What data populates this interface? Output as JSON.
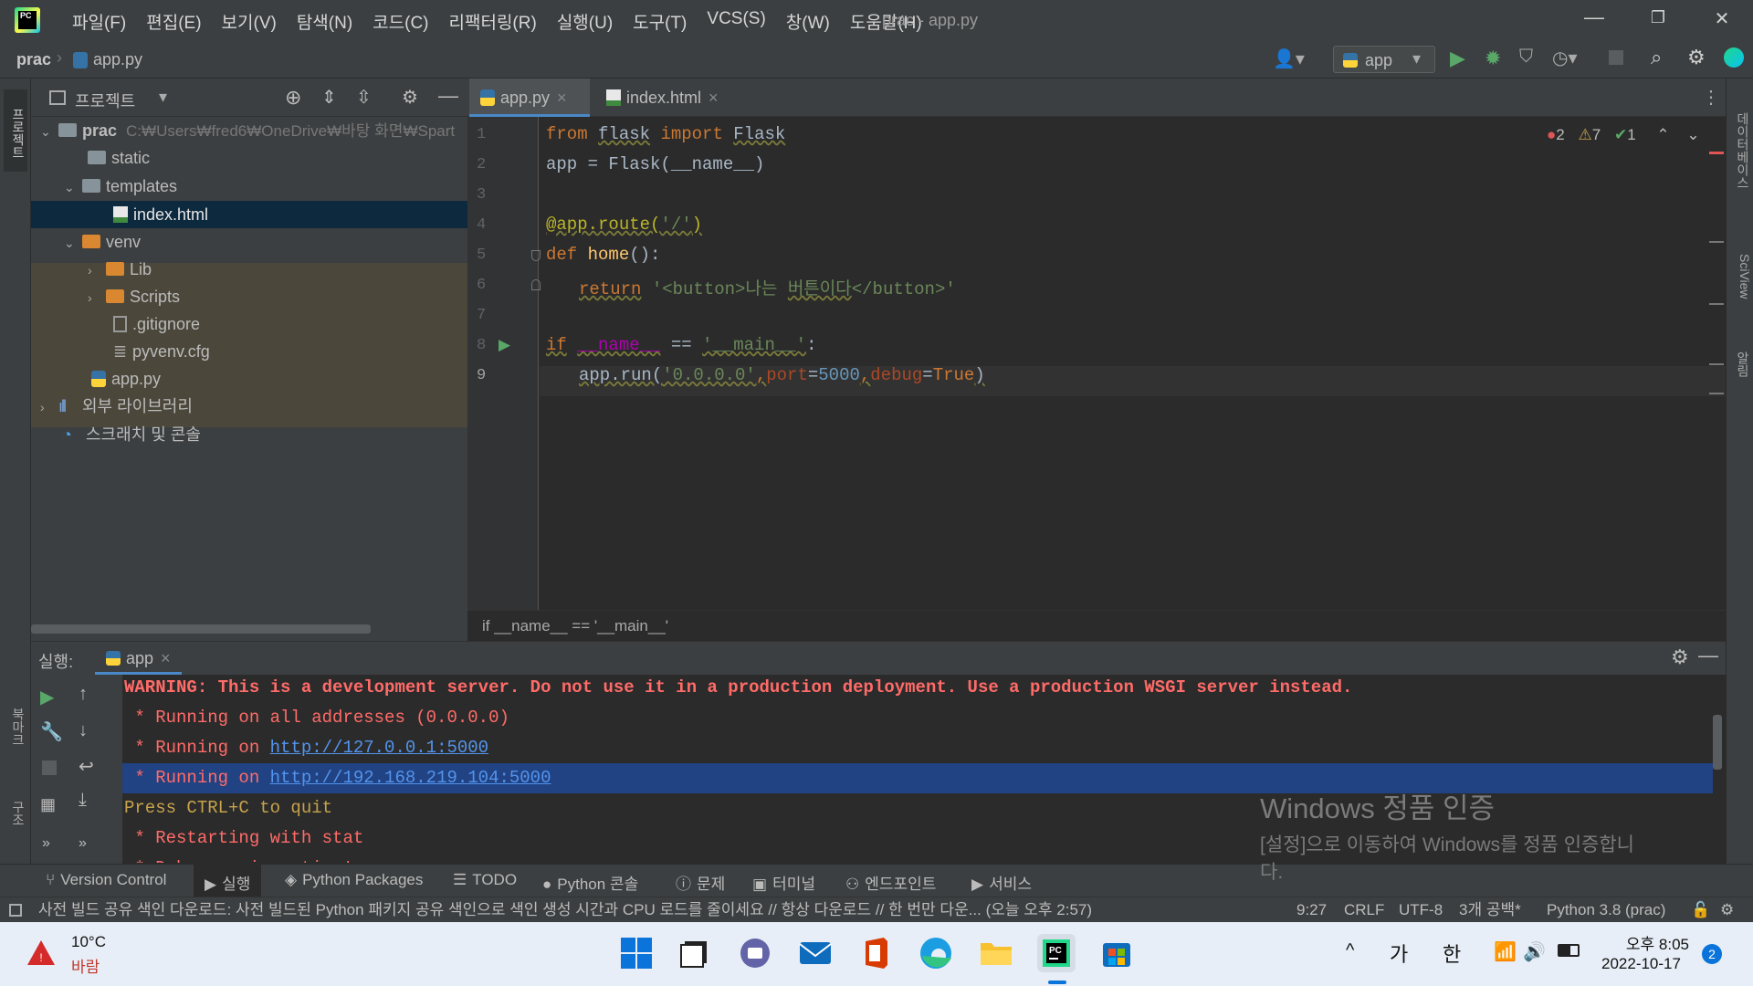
{
  "window": {
    "menus": [
      "파일(F)",
      "편집(E)",
      "보기(V)",
      "탐색(N)",
      "코드(C)",
      "리팩터링(R)",
      "실행(U)",
      "도구(T)",
      "VCS(S)",
      "창(W)",
      "도움말(H)"
    ],
    "title": "prac - app.py",
    "minimize": "—",
    "restore": "❐",
    "close": "✕"
  },
  "navbar": {
    "project": "prac",
    "file": "app.py",
    "run_config": "app"
  },
  "left_tool": {
    "project_tab": "프로젝트",
    "bookmark_tab": "북마크",
    "structure_tab": "구조"
  },
  "project_panel": {
    "title": "프로젝트",
    "tree": [
      {
        "label": "prac",
        "path": "C:₩Users₩fred6₩OneDrive₩바탕 화면₩Spart"
      },
      {
        "label": "static"
      },
      {
        "label": "templates"
      },
      {
        "label": "index.html"
      },
      {
        "label": "venv"
      },
      {
        "label": "Lib"
      },
      {
        "label": "Scripts"
      },
      {
        "label": ".gitignore"
      },
      {
        "label": "pyvenv.cfg"
      },
      {
        "label": "app.py"
      },
      {
        "label": "외부 라이브러리"
      },
      {
        "label": "스크래치 및 콘솔"
      }
    ]
  },
  "editor": {
    "tabs": [
      {
        "label": "app.py",
        "close": "×"
      },
      {
        "label": "index.html",
        "close": "×"
      }
    ],
    "inspections": {
      "errors": "2",
      "warnings": "7",
      "ok": "1"
    },
    "line_numbers": [
      "1",
      "2",
      "3",
      "4",
      "5",
      "6",
      "7",
      "8",
      "9"
    ],
    "code": {
      "l1": [
        "from",
        " ",
        "flask",
        " ",
        "import",
        " ",
        "Flask"
      ],
      "l2": "app = Flask(__name__)",
      "l4": [
        "@app.route(",
        "'/'",
        ")"
      ],
      "l5": [
        "def",
        " ",
        "home",
        "():"
      ],
      "l6": [
        "return",
        " ",
        "'<button>나는 ",
        "버튼이다",
        "</button>'"
      ],
      "l8": [
        "if",
        " ",
        "__name__",
        " == ",
        "'__main__'",
        ":"
      ],
      "l9": [
        "app.run(",
        "'0.0.0.0'",
        ",",
        "port",
        "=",
        "5000",
        ",",
        "debug",
        "=",
        "True",
        ")"
      ]
    },
    "breadcrumb": "if __name__ == '__main__'"
  },
  "right_tool": {
    "database": "데이터베이스",
    "sciview": "SciView",
    "notifications": "알림"
  },
  "run_panel": {
    "label": "실행:",
    "tab": "app",
    "tab_close": "×",
    "lines": [
      "WARNING: This is a development server. Do not use it in a production deployment. Use a production WSGI server instead.",
      " * Running on all addresses (0.0.0.0)",
      " * Running on ",
      "http://127.0.0.1:5000",
      " * Running on ",
      "http://192.168.219.104:5000",
      "Press CTRL+C to quit",
      " * Restarting with stat",
      " * Debugger is active!"
    ]
  },
  "activation": {
    "title": "Windows 정품 인증",
    "line1": "[설정]으로 이동하여 Windows를 정품 인증합니",
    "line2": "다."
  },
  "tool_strip": [
    "Version Control",
    "실행",
    "Python Packages",
    "TODO",
    "Python 콘솔",
    "문제",
    "터미널",
    "엔드포인트",
    "서비스"
  ],
  "status": {
    "message": "사전 빌드 공유 색인 다운로드: 사전 빌드된 Python 패키지 공유 색인으로 색인 생성 시간과 CPU 로드를 줄이세요 // 항상 다운로드 // 한 번만 다운... (오늘 오후 2:57)",
    "position": "9:27",
    "line_sep": "CRLF",
    "encoding": "UTF-8",
    "indent": "3개 공백*",
    "interpreter": "Python 3.8 (prac)"
  },
  "taskbar": {
    "weather_temp": "10°C",
    "weather_desc": "바람",
    "ime1": "가",
    "ime2": "한",
    "time": "오후 8:05",
    "date": "2022-10-17",
    "notif_count": "2",
    "tray_arrow": "^"
  },
  "colors": {
    "accent": "#4a88c7",
    "selection": "#0d293e",
    "venv_bg": "#4b473b",
    "error": "#ff6b68"
  }
}
